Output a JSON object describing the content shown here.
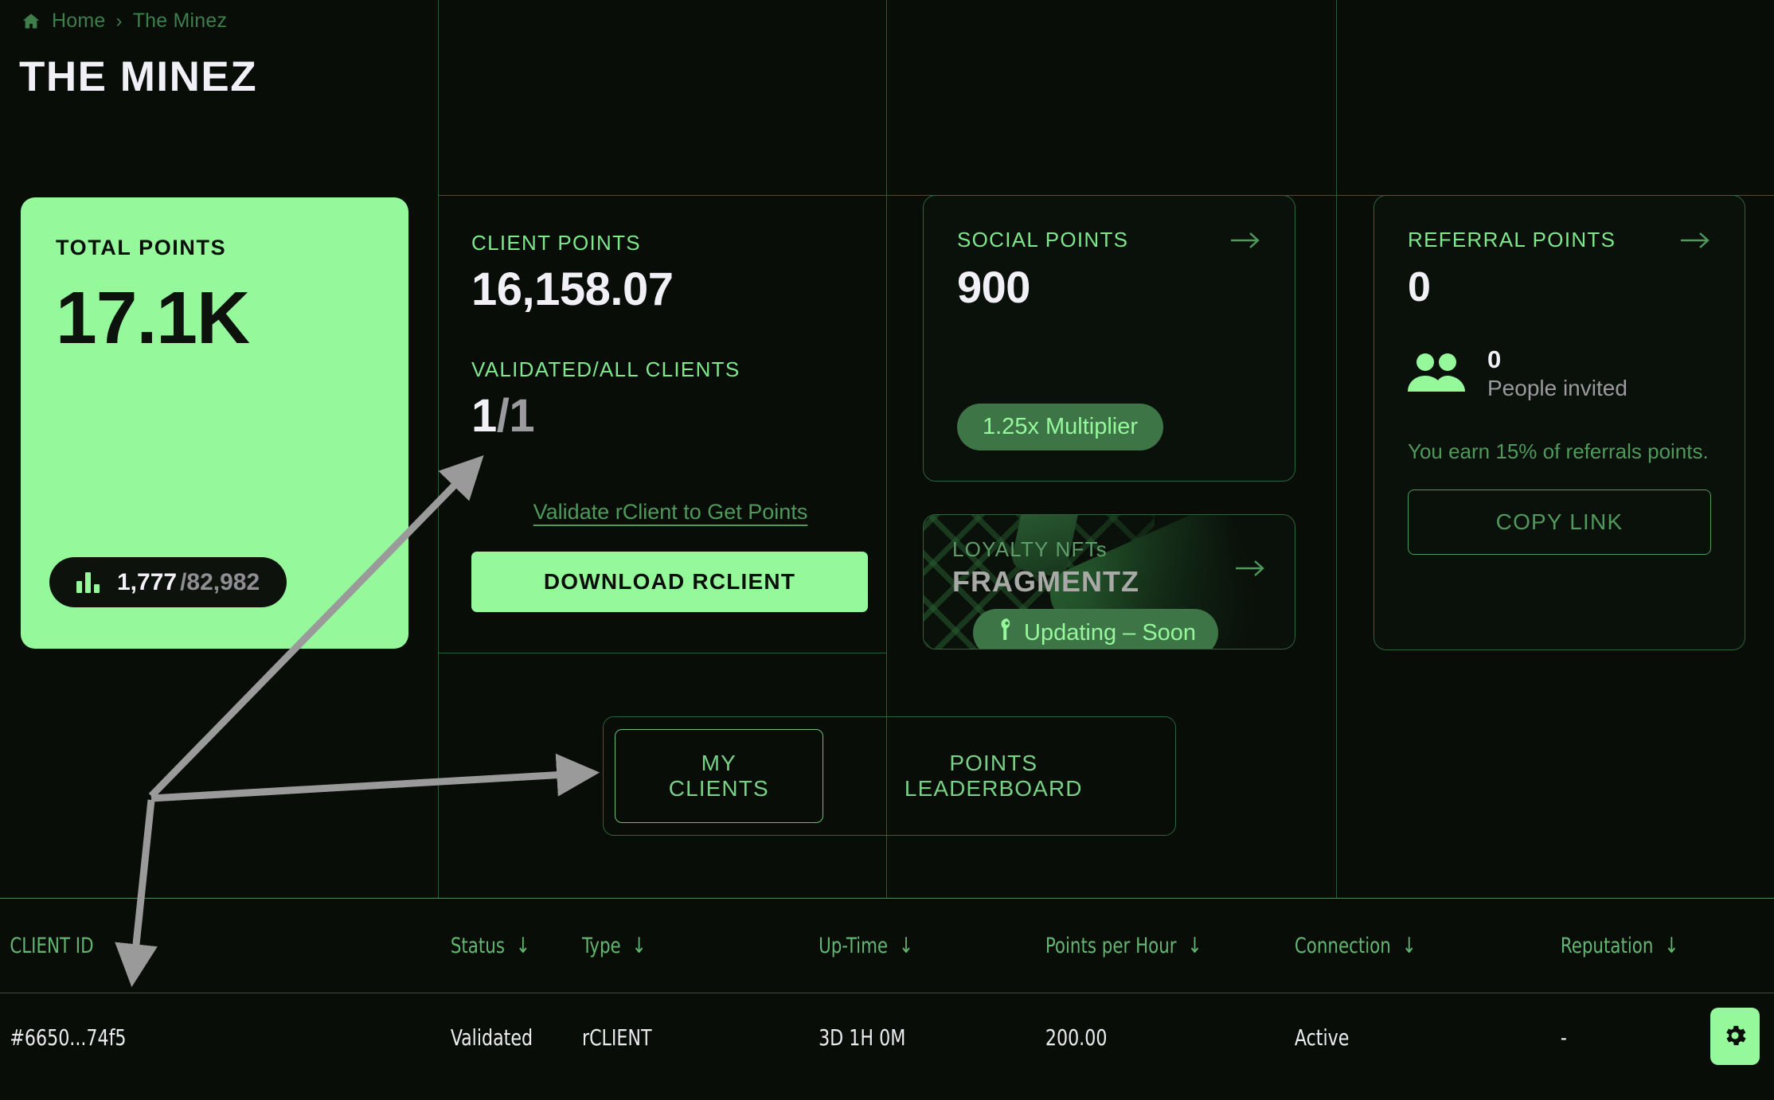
{
  "breadcrumb": {
    "home": "Home",
    "separator": "›",
    "current": "The Minez"
  },
  "page": {
    "title": "THE MINEZ"
  },
  "total_points": {
    "label": "TOTAL POINTS",
    "value": "17.1K",
    "badge_numerator": "1,777",
    "badge_denominator": "/82,982"
  },
  "client_points": {
    "label": "CLIENT POINTS",
    "value": "16,158.07",
    "validated_label": "VALIDATED/ALL CLIENTS",
    "validated_value": "1",
    "validated_total": "/1",
    "validate_link": "Validate rClient to Get Points",
    "download_button": "DOWNLOAD RCLIENT"
  },
  "social_points": {
    "label": "SOCIAL POINTS",
    "value": "900",
    "multiplier": "1.25x Multiplier"
  },
  "loyalty": {
    "kicker": "LOYALTY NFTs",
    "title": "FRAGMENTZ",
    "status": "Updating – Soon"
  },
  "referral": {
    "label": "REFERRAL POINTS",
    "value": "0",
    "invited_count": "0",
    "invited_label": "People invited",
    "earn_note": "You earn 15% of referrals points.",
    "copy_button": "COPY LINK"
  },
  "tabs": [
    {
      "label": "MY CLIENTS",
      "active": true
    },
    {
      "label": "POINTS LEADERBOARD",
      "active": false
    }
  ],
  "table": {
    "columns": [
      "CLIENT ID",
      "Status",
      "Type",
      "Up-Time",
      "Points per Hour",
      "Connection",
      "Reputation"
    ],
    "sortable": [
      false,
      true,
      true,
      true,
      true,
      true,
      true
    ],
    "sort_icon": "↓",
    "rows": [
      {
        "client_id": "#6650...74f5",
        "status": "Validated",
        "type": "rCLIENT",
        "uptime": "3D 1H 0M",
        "points_per_hour": "200.00",
        "connection": "Active",
        "reputation": "-"
      }
    ]
  },
  "colors": {
    "accent_green": "#95f99c",
    "background": "#080d08",
    "border_green": "#2f6338",
    "text_green": "#4f9a5b",
    "annotation_gray": "#9a9a9a"
  }
}
